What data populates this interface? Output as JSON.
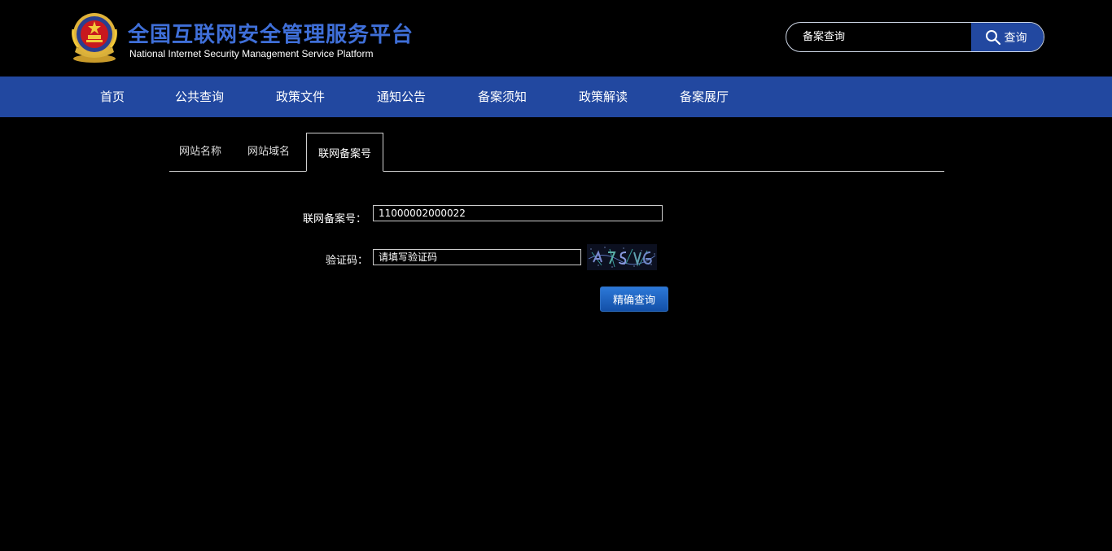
{
  "header": {
    "title_cn": "全国互联网安全管理服务平台",
    "title_en": "National Internet Security Management Service Platform",
    "search": {
      "placeholder": "备案查询",
      "button_label": "查询"
    }
  },
  "nav": {
    "items": [
      "首页",
      "公共查询",
      "政策文件",
      "通知公告",
      "备案须知",
      "政策解读",
      "备案展厅"
    ]
  },
  "tabs": {
    "items": [
      "网站名称",
      "网站域名",
      "联网备案号"
    ],
    "active": "联网备案号"
  },
  "form": {
    "record_label": "联网备案号：",
    "record_value": "11000002000022",
    "captcha_label": "验证码：",
    "captcha_placeholder": "请填写验证码",
    "submit_label": "精确查询"
  },
  "colors": {
    "brand_blue": "#2248a0",
    "title_blue": "#3f6fd8",
    "background": "#000000"
  }
}
